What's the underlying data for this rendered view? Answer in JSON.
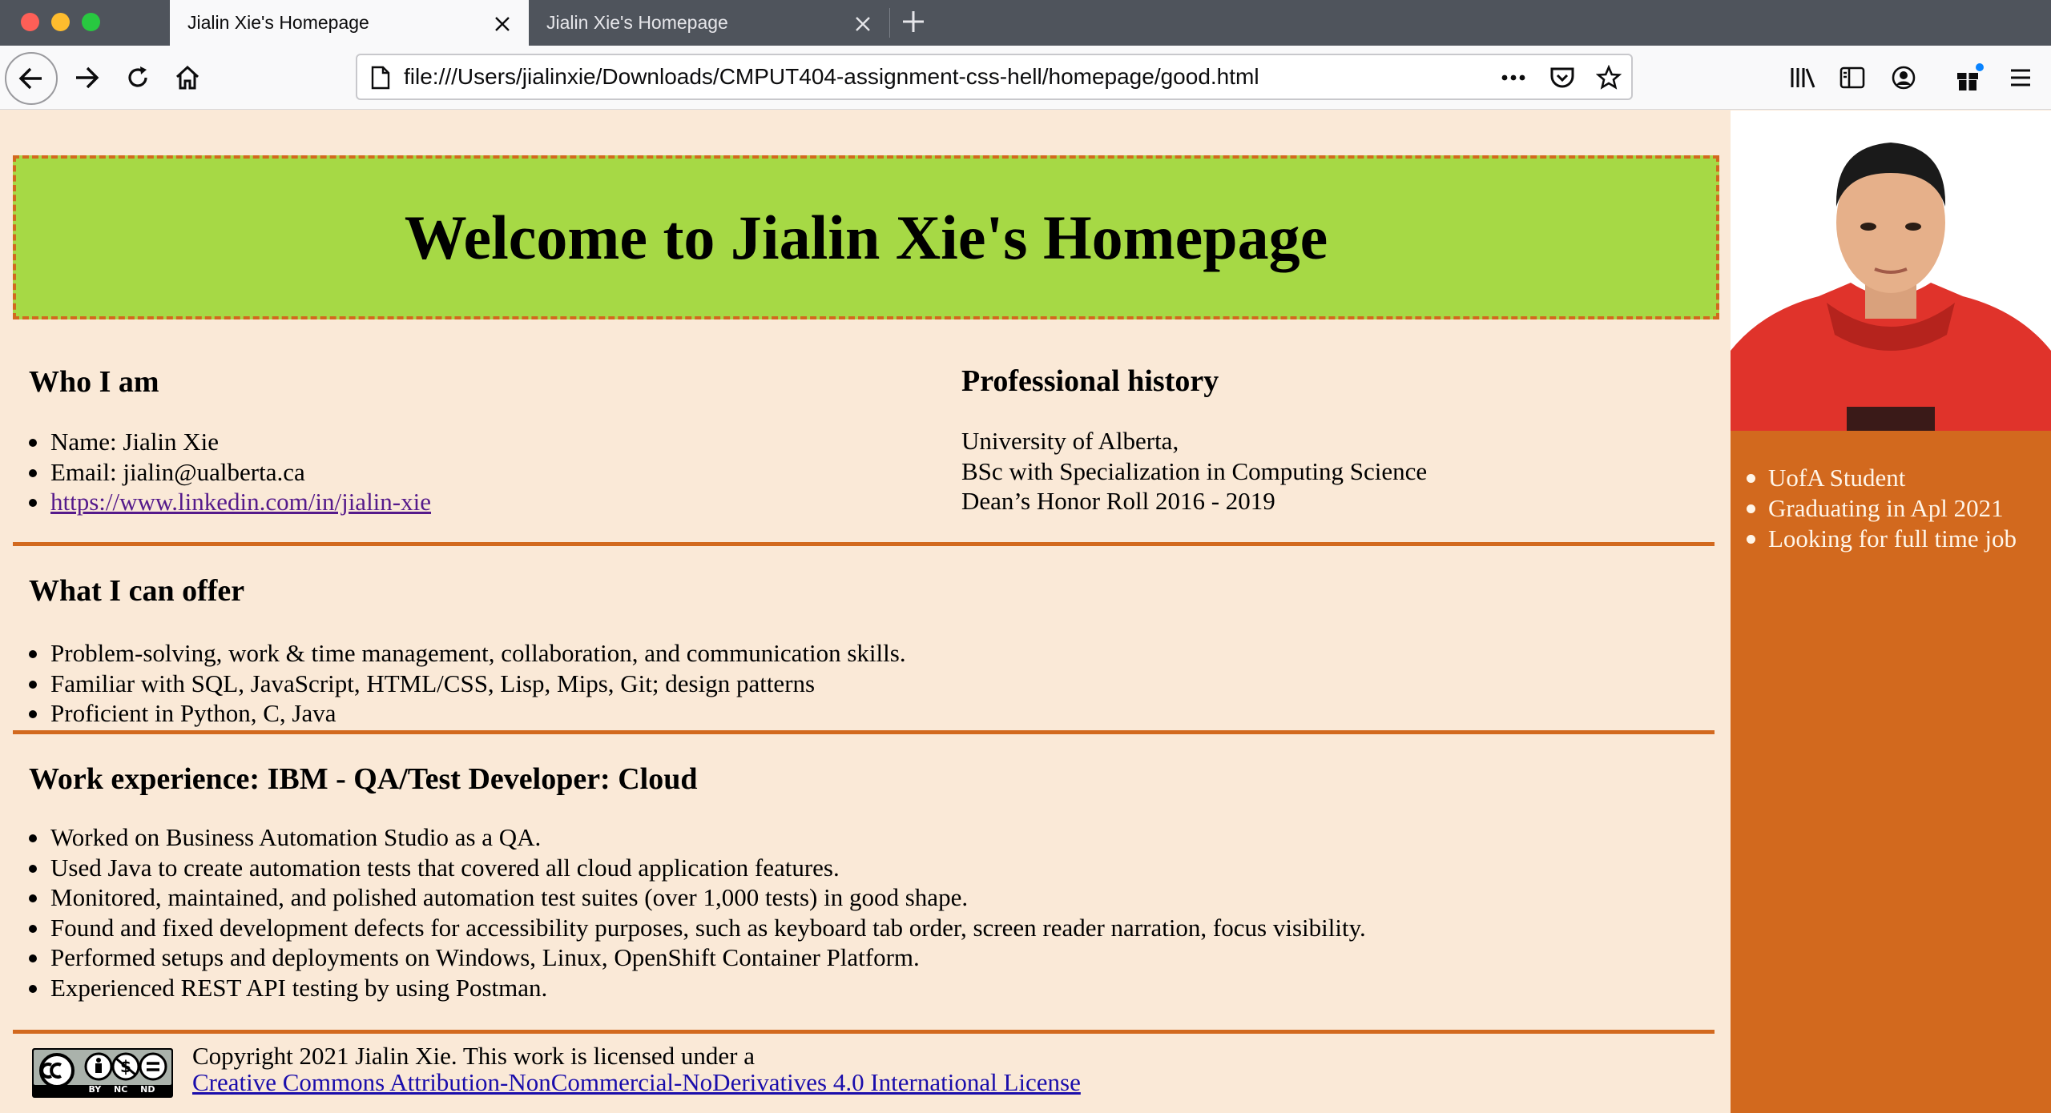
{
  "browser": {
    "tabs": [
      {
        "label": "Jialin Xie's Homepage",
        "active": true
      },
      {
        "label": "Jialin Xie's Homepage",
        "active": false
      }
    ],
    "url": "file:///Users/jialinxie/Downloads/CMPUT404-assignment-css-hell/homepage/good.html"
  },
  "page": {
    "heading": "Welcome to Jialin Xie's Homepage",
    "who": {
      "title": "Who I am",
      "name": "Name: Jialin Xie",
      "email": "Email: jialin@ualberta.ca",
      "link": "https://www.linkedin.com/in/jialin-xie"
    },
    "professional": {
      "title": "Professional history",
      "lines": [
        "University of Alberta,",
        "BSc with Specialization in Computing Science",
        "Dean’s Honor Roll 2016 - 2019"
      ]
    },
    "offer": {
      "title": "What I can offer",
      "items": [
        "Problem-solving, work & time management, collaboration, and communication skills.",
        "Familiar with SQL, JavaScript, HTML/CSS, Lisp, Mips, Git; design patterns",
        "Proficient in Python, C, Java"
      ]
    },
    "work": {
      "title": "Work experience: IBM - QA/Test Developer: Cloud",
      "items": [
        "Worked on Business Automation Studio as a QA.",
        "Used Java to create automation tests that covered all cloud application features.",
        "Monitored, maintained, and polished automation test suites (over 1,000 tests) in good shape.",
        "Found and fixed development defects for accessibility purposes, such as keyboard tab order, screen reader narration, focus visibility.",
        "Performed setups and deployments on Windows, Linux, OpenShift Container Platform.",
        "Experienced REST API testing by using Postman."
      ]
    },
    "footer": {
      "copyright": "Copyright 2021 Jialin Xie. This work is licensed under a",
      "license_link": "Creative Commons Attribution-NonCommercial-NoDerivatives 4.0 International License",
      "badge_text": "BY NC ND"
    }
  },
  "sidebar": {
    "items": [
      "UofA Student",
      "Graduating in Apl 2021",
      "Looking for full time job"
    ]
  },
  "colors": {
    "page_bg": "#fae9d7",
    "banner_bg": "#a6d945",
    "accent": "#d2691e",
    "tab_bar": "#4f545c"
  }
}
